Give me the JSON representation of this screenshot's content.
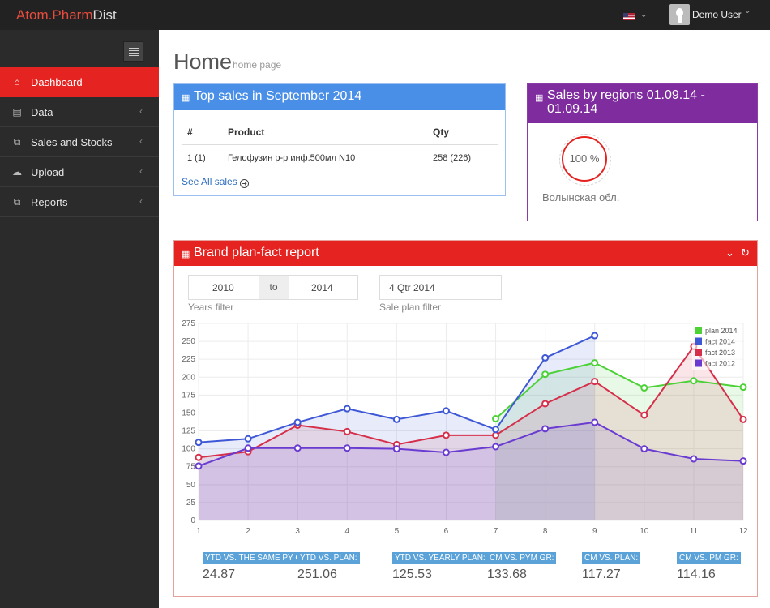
{
  "app": {
    "logo_part1": "Atom.",
    "logo_part2": "Pharm",
    "logo_part3": "Dist"
  },
  "topbar": {
    "language_icon": "us-flag-icon",
    "user_name": "Demo User"
  },
  "sidebar": {
    "items": [
      {
        "label": "Dashboard",
        "icon": "home-icon",
        "active": true
      },
      {
        "label": "Data",
        "icon": "cart-icon"
      },
      {
        "label": "Sales and Stocks",
        "icon": "copy-icon"
      },
      {
        "label": "Upload",
        "icon": "cloud-upload-icon"
      },
      {
        "label": "Reports",
        "icon": "copy-icon"
      }
    ]
  },
  "page": {
    "title": "Home",
    "subtitle": "home page"
  },
  "top_sales": {
    "title": "Top sales in September 2014",
    "columns": [
      "#",
      "Product",
      "Qty"
    ],
    "rows": [
      {
        "rank": "1 (1)",
        "product": "Гелофузин р-р инф.500мл N10",
        "qty": "258 (226)"
      }
    ],
    "see_all": "See All sales"
  },
  "regions": {
    "title": "Sales by regions 01.09.14 - 01.09.14",
    "percent": "100 %",
    "region": "Волынская обл."
  },
  "report": {
    "title": "Brand plan-fact report",
    "years_from": "2010",
    "years_to_label": "to",
    "years_to": "2014",
    "years_caption": "Years filter",
    "plan": "4 Qtr 2014",
    "plan_caption": "Sale plan filter",
    "kpis": [
      {
        "label": "YTD VS. THE SAME PY GR:",
        "value": "24.87"
      },
      {
        "label": "YTD VS. PLAN:",
        "value": "251.06"
      },
      {
        "label": "YTD VS. YEARLY PLAN:",
        "value": "125.53"
      },
      {
        "label": "CM VS. PYM GR:",
        "value": "133.68"
      },
      {
        "label": "CM VS. PLAN:",
        "value": "117.27"
      },
      {
        "label": "CM VS. PM GR:",
        "value": "114.16"
      }
    ]
  },
  "colors": {
    "accent": "#e52421",
    "blue_header": "#4a8fe7",
    "purple_header": "#7f2c9e",
    "kpi_label": "#5aa2d8"
  },
  "chart_data": {
    "type": "area",
    "x": [
      1,
      2,
      3,
      4,
      5,
      6,
      7,
      8,
      9,
      10,
      11,
      12
    ],
    "ylim": [
      0,
      275
    ],
    "yticks": [
      0,
      25,
      50,
      75,
      100,
      125,
      150,
      175,
      200,
      225,
      250,
      275
    ],
    "grid": true,
    "legend_position": "top-right",
    "series": [
      {
        "name": "plan 2014",
        "color": "#4cd137",
        "values": [
          null,
          null,
          null,
          null,
          null,
          null,
          142,
          204,
          220,
          185,
          195,
          186
        ]
      },
      {
        "name": "fact 2014",
        "color": "#3d57d6",
        "values": [
          109,
          114,
          137,
          156,
          141,
          153,
          127,
          227,
          258,
          null,
          null,
          null
        ]
      },
      {
        "name": "fact 2013",
        "color": "#d62f4a",
        "values": [
          88,
          96,
          133,
          124,
          106,
          119,
          119,
          163,
          194,
          147,
          243,
          141
        ]
      },
      {
        "name": "fact 2012",
        "color": "#6a3bd1",
        "values": [
          76,
          101,
          101,
          101,
          100,
          95,
          103,
          128,
          137,
          100,
          86,
          83
        ]
      }
    ]
  }
}
